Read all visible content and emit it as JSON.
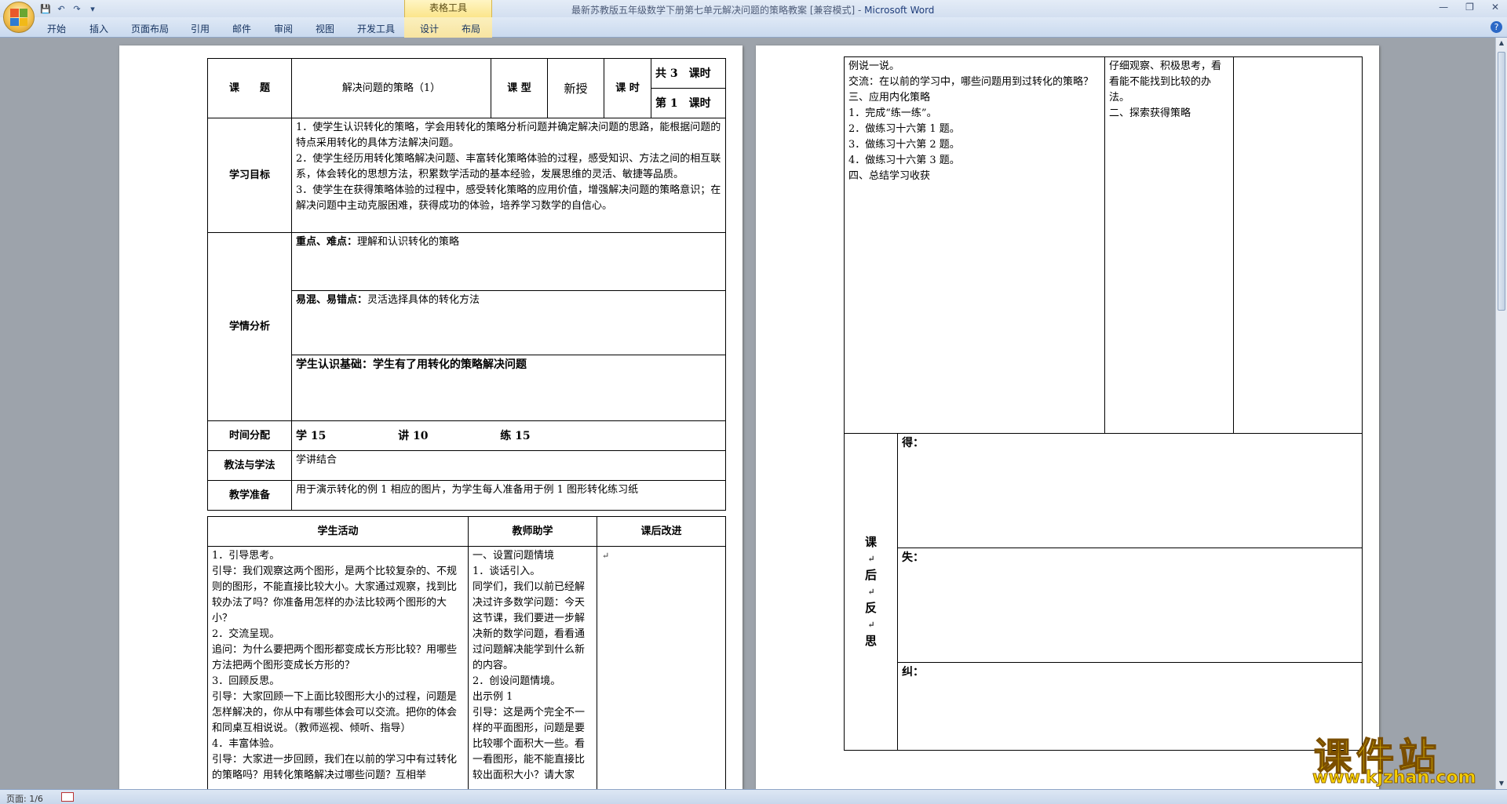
{
  "window": {
    "title": "最新苏教版五年级数学下册第七单元解决问题的策略教案 [兼容模式] - ",
    "app": "Microsoft Word",
    "context_tab_group": "表格工具"
  },
  "ribbon_tabs": [
    "开始",
    "插入",
    "页面布局",
    "引用",
    "邮件",
    "审阅",
    "视图",
    "开发工具",
    "设计",
    "布局"
  ],
  "status": {
    "page": "页面: 1/6"
  },
  "watermark": {
    "brand": "课件站",
    "url": "www.kjzhan.com"
  },
  "page1": {
    "title_label": "课　　题",
    "title_value": "解决问题的策略（1）",
    "type_label": "课  型",
    "type_value": "新授",
    "hours_label": "课  时",
    "hours_total": "共 3　课时",
    "hours_current": "第 1　课时",
    "goals_label": "学习目标",
    "goals": [
      "1．使学生认识转化的策略，学会用转化的策略分析问题并确定解决问题的思路，能根据问题的特点采用转化的具体方法解决问题。",
      "2．使学生经历用转化策略解决问题、丰富转化策略体验的过程，感受知识、方法之间的相互联系，体会转化的思想方法，积累数学活动的基本经验，发展思维的灵活、敏捷等品质。",
      "3．使学生在获得策略体验的过程中，感受转化策略的应用价值，增强解决问题的策略意识；在解决问题中主动克服困难，获得成功的体验，培养学习数学的自信心。"
    ],
    "analysis_label": "学情分析",
    "keypoint_label": "重点、难点：",
    "keypoint_value": "理解和认识转化的策略",
    "confuse_label": "易混、易错点：",
    "confuse_value": "灵活选择具体的转化方法",
    "basis": "学生认识基础：学生有了用转化的策略解决问题",
    "time_label": "时间分配",
    "time_learn": "学 15",
    "time_talk": "讲 10",
    "time_practice": "练 15",
    "method_label": "教法与学法",
    "method_value": "学讲结合",
    "prep_label": "教学准备",
    "prep_value": "用于演示转化的例 1 相应的图片，为学生每人准备用于例 1 图形转化练习纸",
    "col_student": "学生活动",
    "col_teacher": "教师助学",
    "col_after": "课后改进",
    "student_lines": [
      "1．引导思考。",
      "引导：我们观察这两个图形，是两个比较复杂的、不规则的图形，不能直接比较大小。大家通过观察，找到比较办法了吗？你准备用怎样的办法比较两个图形的大小？",
      "2．交流呈现。",
      "追问：为什么要把两个图形都变成长方形比较？用哪些方法把两个图形变成长方形的？",
      "3．回顾反思。",
      "引导：大家回顾一下上面比较图形大小的过程，问题是怎样解决的，你从中有哪些体会可以交流。把你的体会和同桌互相说说。（教师巡视、倾听、指导）",
      "4．丰富体验。",
      "引导：大家进一步回顾，我们在以前的学习中有过转化的策略吗？用转化策略解决过哪些问题？互相举"
    ],
    "teacher_lines": [
      "一、设置问题情境",
      "1．谈话引入。",
      "同学们，我们以前已经解决过许多数学问题：今天这节课，我们要进一步解决新的数学问题，看看通过问题解决能学到什么新的内容。",
      "2．创设问题情境。",
      "出示例 1",
      "引导：这是两个完全不一样的平面图形，问题是要比较哪个面积大一些。看一看图形，能不能直接比较出面积大小？请大家"
    ]
  },
  "page2": {
    "left_lines": [
      "例说一说。",
      "交流：在以前的学习中，哪些问题用到过转化的策略？",
      "三、应用内化策略",
      "1．完成“练一练”。",
      "2．做练习十六第 1 题。",
      "3．做练习十六第 2 题。",
      "4．做练习十六第 3 题。",
      "四、总结学习收获"
    ],
    "mid_lines": [
      "仔细观察、积极思考，看看能不能找到比较的办法。",
      "二、探索获得策略"
    ],
    "reflect_chars": [
      "课",
      "后",
      "反",
      "思"
    ],
    "gain_label": "得：",
    "loss_label": "失：",
    "fix_label": "纠："
  }
}
